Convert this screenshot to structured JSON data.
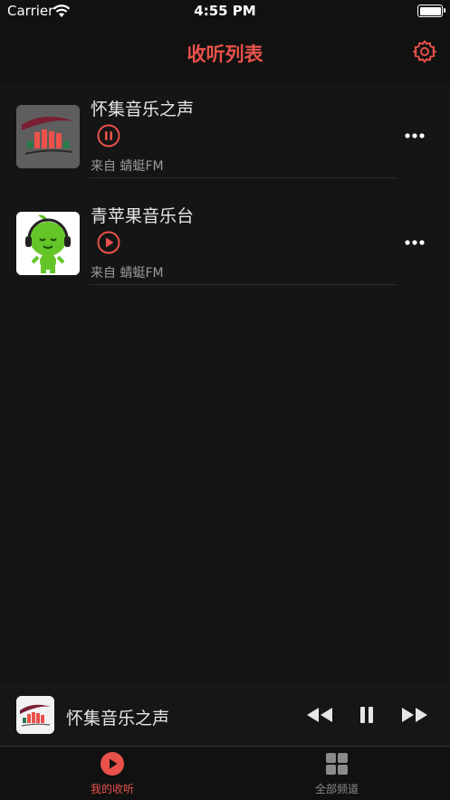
{
  "status_bar": {
    "carrier": "Carrier",
    "time": "4:55 PM"
  },
  "nav": {
    "title": "收听列表",
    "settings_icon": "gear-icon"
  },
  "stations": [
    {
      "title": "怀集音乐之声",
      "state": "playing",
      "source": "来自 蜻蜓FM"
    },
    {
      "title": "青苹果音乐台",
      "state": "paused",
      "source": "来自 蜻蜓FM"
    }
  ],
  "mini_player": {
    "title": "怀集音乐之声"
  },
  "tabs": [
    {
      "label": "我的收听",
      "icon": "play-circle-icon",
      "active": true
    },
    {
      "label": "全部频道",
      "icon": "grid-icon",
      "active": false
    }
  ],
  "colors": {
    "accent": "#e8524a",
    "background": "#151515",
    "inactive": "#8a8a8a"
  }
}
